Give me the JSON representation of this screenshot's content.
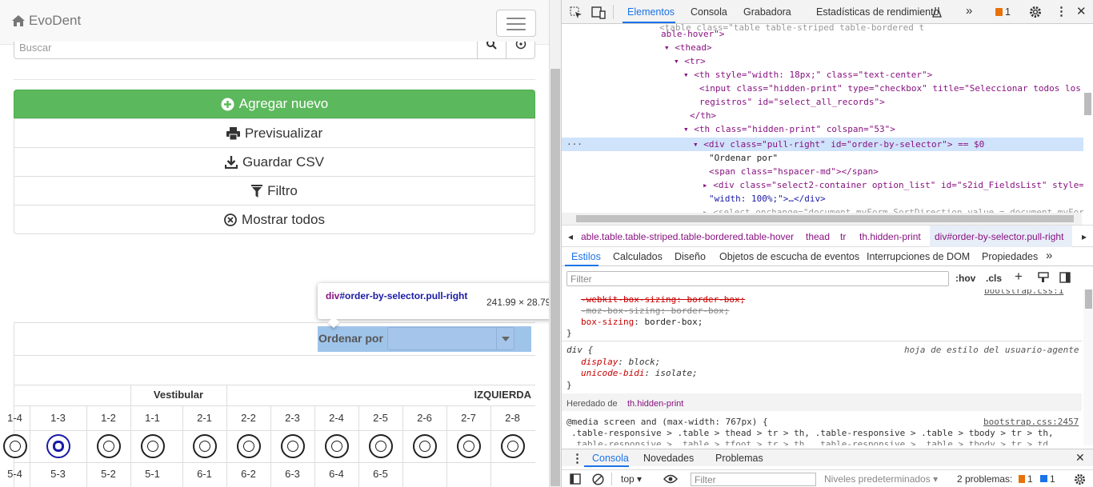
{
  "page": {
    "brand": "EvoDent",
    "search_placeholder": "Buscar",
    "buttons": {
      "add": "Agregar nuevo",
      "preview": "Previsualizar",
      "csv": "Guardar CSV",
      "filter": "Filtro",
      "show_all": "Mostrar todos"
    },
    "tooltip": {
      "selector_tag": "div",
      "selector_rest": "#order-by-selector.pull-right",
      "size": "241.99 × 28.79"
    },
    "order_by_label": "Ordenar por",
    "table": {
      "group_vestibular": "Vestibular",
      "group_izquierda": "IZQUIERDA",
      "upper_numbers": [
        "1-4",
        "1-3",
        "1-2",
        "1-1",
        "2-1",
        "2-2",
        "2-3",
        "2-4",
        "2-5",
        "2-6",
        "2-7",
        "2-8"
      ],
      "lower_numbers": [
        "5-4",
        "5-3",
        "5-2",
        "5-1",
        "6-1",
        "6-2",
        "6-3",
        "6-4",
        "6-5",
        "",
        "",
        ""
      ]
    }
  },
  "devtools": {
    "tabs": [
      "Elementos",
      "Consola",
      "Grabadora",
      "Estadísticas de rendimiento"
    ],
    "issues_count": "1",
    "dom_lines": [
      {
        "text": "able-hover\">"
      },
      {
        "text": "<thead>"
      },
      {
        "text": "<tr>"
      },
      {
        "text": "<th style=\"width: 18px;\" class=\"text-center\">"
      },
      {
        "text": "<input class=\"hidden-print\" type=\"checkbox\" title=\"Seleccionar todos los"
      },
      {
        "text": "registros\" id=\"select_all_records\">"
      },
      {
        "text": "</th>"
      },
      {
        "text": "<th class=\"hidden-print\" colspan=\"53\">"
      },
      {
        "text": "<div class=\"pull-right\" id=\"order-by-selector\"> == $0"
      },
      {
        "text": "\"Ordenar por\""
      },
      {
        "text": "<span class=\"hspacer-md\"></span>"
      },
      {
        "text": "<div class=\"select2-container option_list\" id=\"s2id_FieldsList\" style="
      },
      {
        "text": "\"width: 100%;\">…</div>"
      }
    ],
    "breadcrumbs": [
      "able.table.table-striped.table-bordered.table-hover",
      "thead",
      "tr",
      "th.hidden-print",
      "div#order-by-selector.pull-right"
    ],
    "style_tabs": [
      "Estilos",
      "Calculados",
      "Diseño",
      "Objetos de escucha de eventos",
      "Interrupciones de DOM",
      "Propiedades"
    ],
    "filter_placeholder": "Filter",
    "hov": ":hov",
    "cls": ".cls",
    "css_lines": [
      "-webkit-box-sizing: border-box;",
      "-moz-box-sizing: border-box;",
      "box-sizing: border-box;",
      "}",
      "div {",
      "hoja de estilo del usuario-agente",
      "display: block;",
      "unicode-bidi: isolate;",
      "}",
      "Heredado de",
      "th.hidden-print",
      "@media screen and (max-width: 767px) {",
      "bootstrap.css:2457",
      ".table-responsive > .table > thead > tr > th, .table-responsive > .table > tbody > tr > th,",
      ".table-responsive > .table > tfoot > tr > th, .table-responsive > .table > tbody > tr > td"
    ],
    "drawer_tabs": [
      "Consola",
      "Novedades",
      "Problemas"
    ],
    "console": {
      "context": "top",
      "filter_placeholder": "Filter",
      "levels": "Niveles predeterminados",
      "problems": "2 problemas:",
      "p1": "1",
      "p2": "1"
    }
  }
}
